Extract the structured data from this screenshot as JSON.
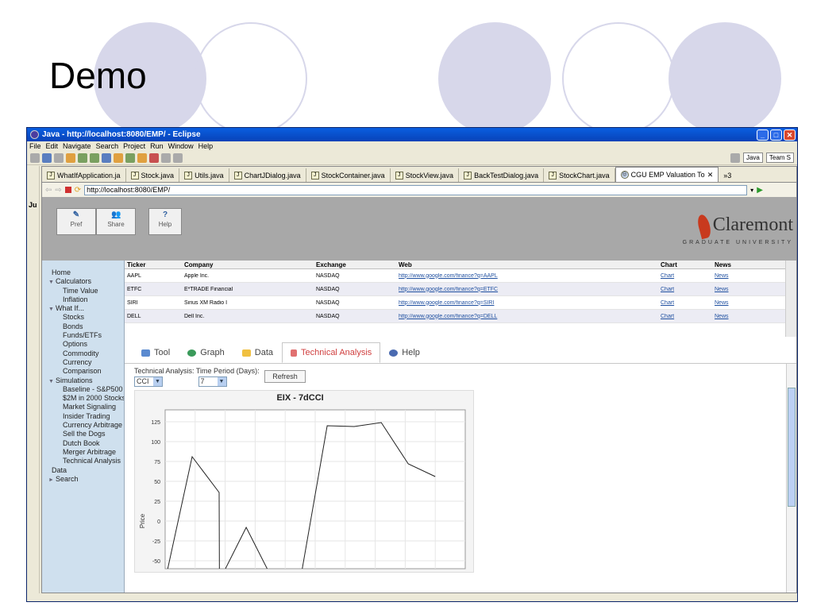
{
  "slide": {
    "title": "Demo"
  },
  "window": {
    "title": "Java - http://localhost:8080/EMP/ - Eclipse",
    "menu": [
      "File",
      "Edit",
      "Navigate",
      "Search",
      "Project",
      "Run",
      "Window",
      "Help"
    ],
    "perspectives": [
      "Java",
      "Team S"
    ],
    "tabs": [
      "WhatIfApplication.ja",
      "Stock.java",
      "Utils.java",
      "ChartJDialog.java",
      "StockContainer.java",
      "StockView.java",
      "BackTestDialog.java",
      "StockChart.java",
      "CGU EMP Valuation To"
    ],
    "more_tabs": "»3",
    "url": "http://localhost:8080/EMP/",
    "left_trim_label": "Ju"
  },
  "app": {
    "header_buttons": [
      "Pref",
      "Share",
      "Help"
    ],
    "logo": {
      "name": "Claremont",
      "subtitle": "GRADUATE UNIVERSITY"
    },
    "nav": [
      {
        "label": "Home",
        "level": 0
      },
      {
        "label": "Calculators",
        "level": 0,
        "expandable": true
      },
      {
        "label": "Time Value",
        "level": 1
      },
      {
        "label": "Inflation",
        "level": 1
      },
      {
        "label": "What If...",
        "level": 0,
        "expandable": true
      },
      {
        "label": "Stocks",
        "level": 1
      },
      {
        "label": "Bonds",
        "level": 1
      },
      {
        "label": "Funds/ETFs",
        "level": 1
      },
      {
        "label": "Options",
        "level": 1
      },
      {
        "label": "Commodity",
        "level": 1
      },
      {
        "label": "Currency",
        "level": 1
      },
      {
        "label": "Comparison",
        "level": 1
      },
      {
        "label": "Simulations",
        "level": 0,
        "expandable": true
      },
      {
        "label": "Baseline - S&P500",
        "level": 1
      },
      {
        "label": "$2M in 2000 Stocks",
        "level": 1
      },
      {
        "label": "Market Signaling",
        "level": 1
      },
      {
        "label": "Insider Trading",
        "level": 1
      },
      {
        "label": "Currency Arbitrage",
        "level": 1
      },
      {
        "label": "Sell the Dogs",
        "level": 1
      },
      {
        "label": "Dutch Book",
        "level": 1
      },
      {
        "label": "Merger Arbitrage",
        "level": 1
      },
      {
        "label": "Technical Analysis",
        "level": 1
      },
      {
        "label": "Data",
        "level": 0
      },
      {
        "label": "Search",
        "level": 0,
        "collapsed": true
      }
    ],
    "table": {
      "headers": [
        "Ticker",
        "Company",
        "Exchange",
        "Web",
        "Chart",
        "News"
      ],
      "rows": [
        [
          "AAPL",
          "Apple Inc.",
          "NASDAQ",
          "http://www.google.com/finance?q=AAPL",
          "Chart",
          "News"
        ],
        [
          "ETFC",
          "E*TRADE Financial",
          "NASDAQ",
          "http://www.google.com/finance?q=ETFC",
          "Chart",
          "News"
        ],
        [
          "SIRI",
          "Sirius XM Radio I",
          "NASDAQ",
          "http://www.google.com/finance?q=SIRI",
          "Chart",
          "News"
        ],
        [
          "DELL",
          "Dell Inc.",
          "NASDAQ",
          "http://www.google.com/finance?q=DELL",
          "Chart",
          "News"
        ]
      ]
    },
    "panel_tabs": [
      "Tool",
      "Graph",
      "Data",
      "Technical Analysis",
      "Help"
    ],
    "active_panel_tab": "Technical Analysis",
    "controls": {
      "ta_label": "Technical Analysis:",
      "period_label": "Time Period (Days):",
      "indicator": "CCI",
      "period": "7",
      "refresh": "Refresh"
    }
  },
  "chart_data": {
    "type": "line",
    "title": "EIX - 7dCCI",
    "ylabel": "Price",
    "xlabel": "",
    "y_ticks": [
      125,
      100,
      75,
      50,
      25,
      0,
      -25,
      -50
    ],
    "ylim": [
      -60,
      140
    ],
    "grid": true,
    "series": [
      {
        "values": [
          [
            0,
            -75
          ],
          [
            1,
            81
          ],
          [
            2,
            36
          ],
          [
            2.01,
            -75
          ],
          [
            3,
            -8
          ],
          [
            4,
            -75
          ],
          [
            5,
            -75
          ],
          [
            6,
            120
          ],
          [
            7,
            119
          ],
          [
            8,
            124
          ],
          [
            9,
            72
          ],
          [
            10,
            56
          ]
        ]
      }
    ]
  }
}
